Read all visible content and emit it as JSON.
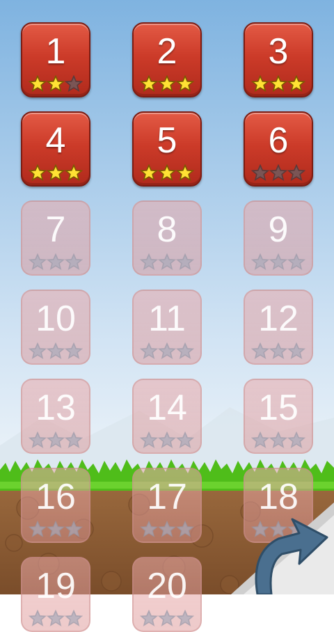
{
  "levels": [
    {
      "number": "1",
      "stars": 2,
      "locked": false
    },
    {
      "number": "2",
      "stars": 3,
      "locked": false
    },
    {
      "number": "3",
      "stars": 3,
      "locked": false
    },
    {
      "number": "4",
      "stars": 3,
      "locked": false
    },
    {
      "number": "5",
      "stars": 3,
      "locked": false
    },
    {
      "number": "6",
      "stars": 0,
      "locked": false
    },
    {
      "number": "7",
      "stars": 0,
      "locked": true
    },
    {
      "number": "8",
      "stars": 0,
      "locked": true
    },
    {
      "number": "9",
      "stars": 0,
      "locked": true
    },
    {
      "number": "10",
      "stars": 0,
      "locked": true
    },
    {
      "number": "11",
      "stars": 0,
      "locked": true
    },
    {
      "number": "12",
      "stars": 0,
      "locked": true
    },
    {
      "number": "13",
      "stars": 0,
      "locked": true
    },
    {
      "number": "14",
      "stars": 0,
      "locked": true
    },
    {
      "number": "15",
      "stars": 0,
      "locked": true
    },
    {
      "number": "16",
      "stars": 0,
      "locked": true
    },
    {
      "number": "17",
      "stars": 0,
      "locked": true
    },
    {
      "number": "18",
      "stars": 0,
      "locked": true
    },
    {
      "number": "19",
      "stars": 0,
      "locked": true
    },
    {
      "number": "20",
      "stars": 0,
      "locked": true
    }
  ],
  "max_stars": 3,
  "next_button": {
    "icon": "curved-arrow-right-icon"
  },
  "colors": {
    "sky_top": "#7fb3e0",
    "sky_bottom": "#eaf2f8",
    "tile_unlocked": "#cc3b29",
    "grass": "#55c21e",
    "dirt": "#8b5a33",
    "star_on": "#ffe234"
  }
}
